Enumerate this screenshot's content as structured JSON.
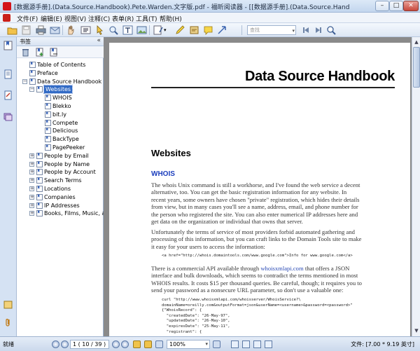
{
  "window": {
    "title": "[数据源手册].(Data.Source.Handbook).Pete.Warden.文字版.pdf - 福昕阅读器 - [[数据源手册].(Data.Source.Handbook).Pete.Warden.文字版.pdf]",
    "min_label": "–",
    "max_label": "□",
    "close_label": "✕"
  },
  "menu": {
    "items": [
      "文件(F)",
      "编辑(E)",
      "视图(V)",
      "注释(C)",
      "表单(R)",
      "工具(T)",
      "帮助(H)"
    ]
  },
  "toolbar": {
    "search_placeholder": "查找"
  },
  "panel": {
    "title": "书签",
    "close_label": "«"
  },
  "tree": {
    "items": [
      {
        "label": "Table of Contents",
        "level": 1,
        "expander": ""
      },
      {
        "label": "Preface",
        "level": 1,
        "expander": ""
      },
      {
        "label": "Data Source Handbook",
        "level": 1,
        "expander": "−"
      },
      {
        "label": "Websites",
        "level": 2,
        "expander": "−",
        "selected": true
      },
      {
        "label": "WHOIS",
        "level": 3,
        "expander": ""
      },
      {
        "label": "Blekko",
        "level": 3,
        "expander": ""
      },
      {
        "label": "bit.ly",
        "level": 3,
        "expander": ""
      },
      {
        "label": "Compete",
        "level": 3,
        "expander": ""
      },
      {
        "label": "Delicious",
        "level": 3,
        "expander": ""
      },
      {
        "label": "BackType",
        "level": 3,
        "expander": ""
      },
      {
        "label": "PagePeeker",
        "level": 3,
        "expander": ""
      },
      {
        "label": "People by Email",
        "level": 2,
        "expander": "+"
      },
      {
        "label": "People by Name",
        "level": 2,
        "expander": "+"
      },
      {
        "label": "People by Account",
        "level": 2,
        "expander": "+"
      },
      {
        "label": "Search Terms",
        "level": 2,
        "expander": "+"
      },
      {
        "label": "Locations",
        "level": 2,
        "expander": "+"
      },
      {
        "label": "Companies",
        "level": 2,
        "expander": "+"
      },
      {
        "label": "IP Addresses",
        "level": 2,
        "expander": "+"
      },
      {
        "label": "Books, Films, Music, and",
        "level": 2,
        "expander": "+"
      }
    ]
  },
  "page": {
    "book_title": "Data Source Handbook",
    "section_title": "Websites",
    "subsection_title": "WHOIS",
    "para1": "The whois Unix command is still a workhorse, and I've found the web service a decent alternative, too. You can get the basic registration information for any website. In recent years, some owners have chosen \"private\" registration, which hides their details from view, but in many cases you'll see a name, address, email, and phone number for the person who registered the site. You can also enter numerical IP addresses here and get data on the organization or individual that owns that server.",
    "para2": "Unfortunately the terms of service of most providers forbid automated gathering and processing of this information, but you can craft links to the Domain Tools site to make it easy for your users to access the information:",
    "code1": "<a href=\"http://whois.domaintools.com/www.google.com\">Info for www.google.com</a>",
    "para3_pre": "There is a commercial API available through ",
    "para3_link": "whoisxmlapi.com",
    "para3_post": " that offers a JSON interface and bulk downloads, which seems to contradict the terms mentioned in most WHOIS results. It costs $15 per thousand queries. Be careful, though; it requires you to send your password as a nonsecure URL parameter, so don't use a valuable one:",
    "code2": "curl \"http://www.whoisxmlapi.com/whoisserver/WhoisService?\\\ndomainName=oreilly.com&outputFormat=json&userName=<username>&password=<password>\"\n{\"WhoisRecord\": {\n  \"createdDate\": \"26-May-97\",\n  \"updatedDate\": \"26-May-10\",\n  \"expiresDate\": \"25-May-11\",\n  \"registrant\": {"
  },
  "status": {
    "left": "就绪",
    "page_display": "1  ( 10 / 39 )",
    "zoom": "100%",
    "page_size": "文件: [7.00 * 9.19 英寸]"
  },
  "colors": {
    "selection": "#316ac5",
    "link": "#2b4bb5",
    "subheading": "#1a3dbd"
  }
}
